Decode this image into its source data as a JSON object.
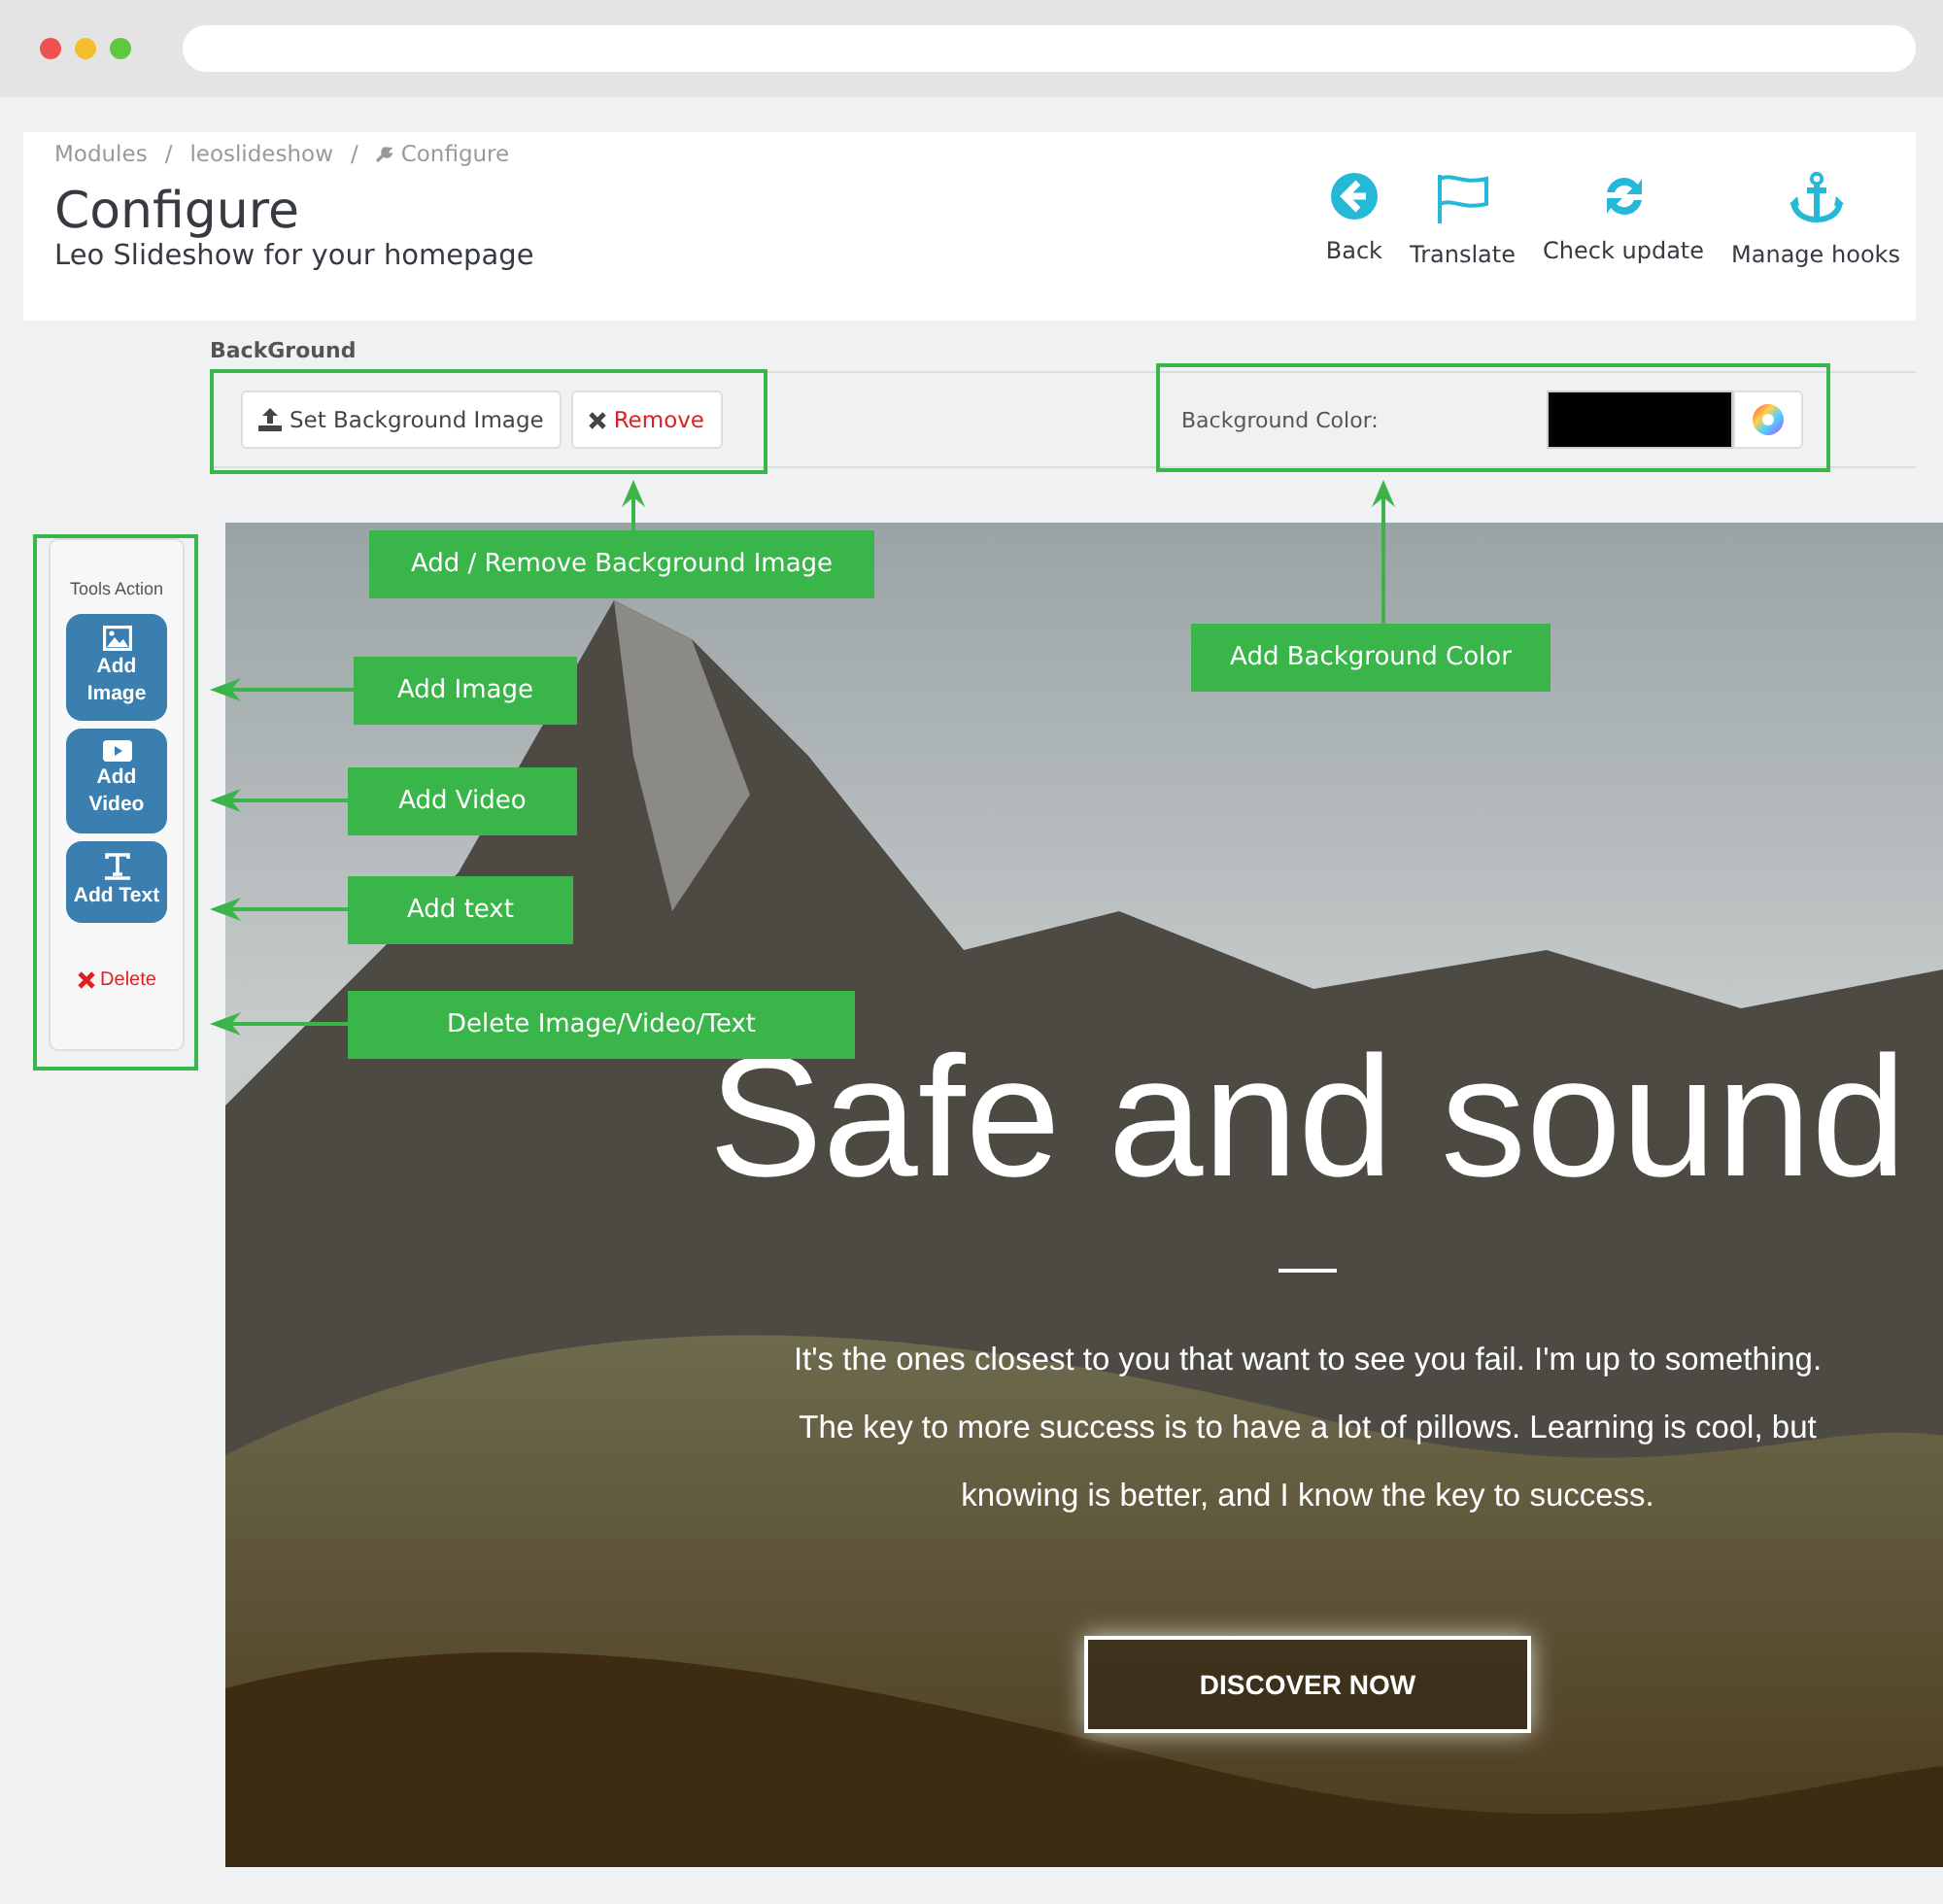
{
  "breadcrumb": [
    "Modules",
    "leoslideshow",
    "Configure"
  ],
  "page_title": "Configure",
  "subtitle": "Leo Slideshow for your homepage",
  "toolbar": [
    {
      "label": "Back",
      "kind": "back"
    },
    {
      "label": "Translate",
      "kind": "flag"
    },
    {
      "label": "Check update",
      "kind": "refresh"
    },
    {
      "label": "Manage hooks",
      "kind": "anchor"
    }
  ],
  "breadcrumb_separators": [
    "/",
    "/"
  ],
  "background": {
    "heading": "BackGround",
    "set_button": "Set Background Image",
    "remove_button": "Remove",
    "color_label": "Background Color:"
  },
  "tools": {
    "title": "Tools Action",
    "buttons": [
      {
        "label": "Add Image",
        "kind": "image"
      },
      {
        "label": "Add Video",
        "kind": "video"
      },
      {
        "label": "Add Text",
        "kind": "text"
      }
    ],
    "delete": "Delete"
  },
  "slide": {
    "headline": "Safe and sound",
    "body": "It's the ones closest to you that want to see you fail. I'm up to something. The key to more success is to have a lot of pillows. Learning is cool, but knowing is better, and I know the key to success.",
    "button": "DISCOVER NOW"
  },
  "callouts": [
    "Add / Remove Background Image",
    "Add Background Color",
    "Add Image",
    "Add Video",
    "Add text",
    "Delete Image/Video/Text"
  ]
}
